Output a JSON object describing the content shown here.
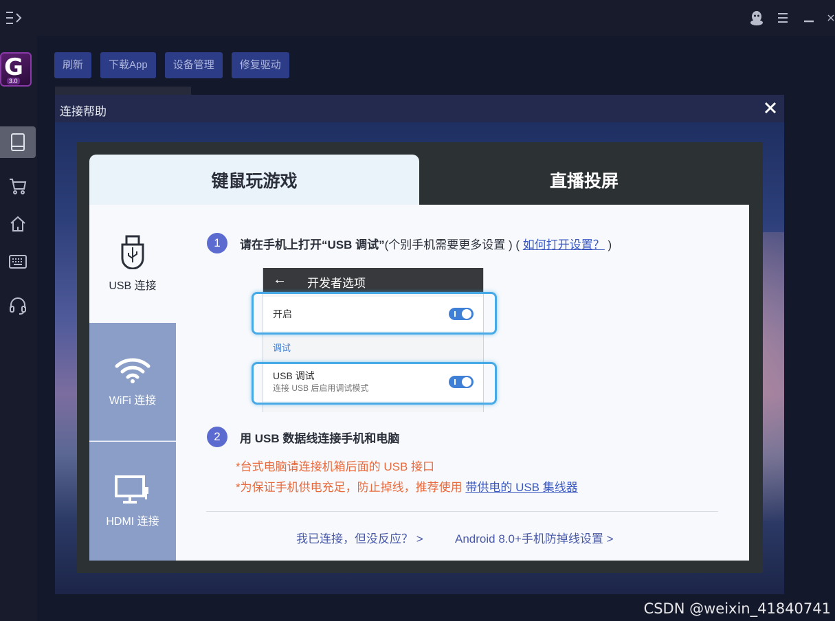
{
  "toolbar": {
    "refresh": "刷新",
    "download_app": "下载App",
    "device_manage": "设备管理",
    "repair_driver": "修复驱动"
  },
  "logo": {
    "version": "3.0"
  },
  "dialog": {
    "title": "连接帮助",
    "tabs": {
      "keyboard_mouse": "键鼠玩游戏",
      "live_cast": "直播投屏"
    },
    "side": {
      "usb": "USB 连接",
      "wifi": "WiFi 连接",
      "hdmi": "HDMI 连接"
    },
    "step1": {
      "num": "1",
      "bold": "请在手机上打开“USB 调试”",
      "plain": "(个别手机需要更多设置 ) (",
      "link": "如何打开设置？",
      "end": ")"
    },
    "phone": {
      "header": "开发者选项",
      "enable": "开启",
      "section": "调试",
      "usb_debug": "USB 调试",
      "usb_debug_sub": "连接 USB 后启用调试模式"
    },
    "step2": {
      "num": "2",
      "text": "用 USB 数据线连接手机和电脑"
    },
    "note1": "*台式电脑请连接机箱后面的 USB 接口",
    "note2_prefix": "*为保证手机供电充足，防止掉线，推荐使用 ",
    "note2_link": "带供电的 USB 集线器",
    "bottom_links": {
      "no_response": "我已连接，但没反应？ >",
      "android": "Android 8.0+手机防掉线设置 >"
    }
  },
  "watermark": "CSDN @weixin_41840741",
  "colors": {
    "accent": "#5b6bd0",
    "toolbar_button": "#2c3c86",
    "note": "#e86a3c",
    "link": "#3a58c0"
  }
}
